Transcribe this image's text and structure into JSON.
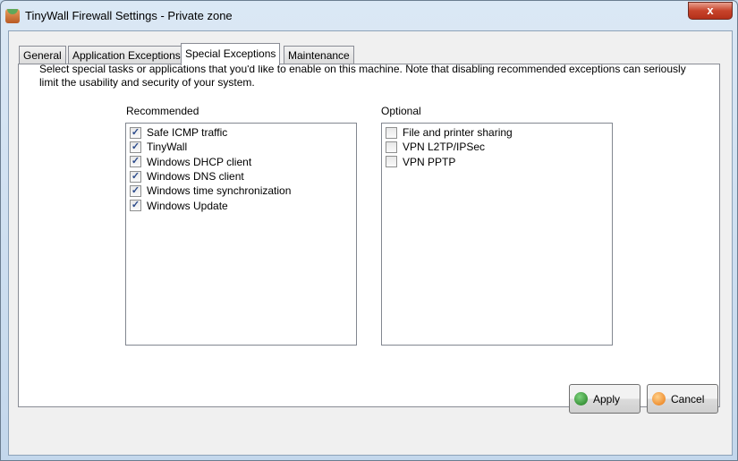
{
  "window": {
    "title": "TinyWall Firewall Settings - Private zone",
    "close": "x"
  },
  "tabs": [
    {
      "label": "General"
    },
    {
      "label": "Application Exceptions"
    },
    {
      "label": "Special Exceptions"
    },
    {
      "label": "Maintenance"
    }
  ],
  "description": "Select special tasks or applications that you'd like to enable on this machine. Note that disabling recommended exceptions can seriously limit the usability and security of your system.",
  "recommended": {
    "label": "Recommended",
    "items": [
      {
        "label": "Safe ICMP traffic",
        "checked": true
      },
      {
        "label": "TinyWall",
        "checked": true
      },
      {
        "label": "Windows DHCP client",
        "checked": true
      },
      {
        "label": "Windows DNS client",
        "checked": true
      },
      {
        "label": "Windows time synchronization",
        "checked": true
      },
      {
        "label": "Windows Update",
        "checked": true
      }
    ]
  },
  "optional": {
    "label": "Optional",
    "items": [
      {
        "label": "File and printer sharing",
        "checked": false
      },
      {
        "label": "VPN L2TP/IPSec",
        "checked": false
      },
      {
        "label": "VPN PPTP",
        "checked": false
      }
    ]
  },
  "buttons": {
    "apply": "Apply",
    "cancel": "Cancel",
    "apply_color": "#2e8b2e",
    "cancel_color": "#f08a20"
  }
}
